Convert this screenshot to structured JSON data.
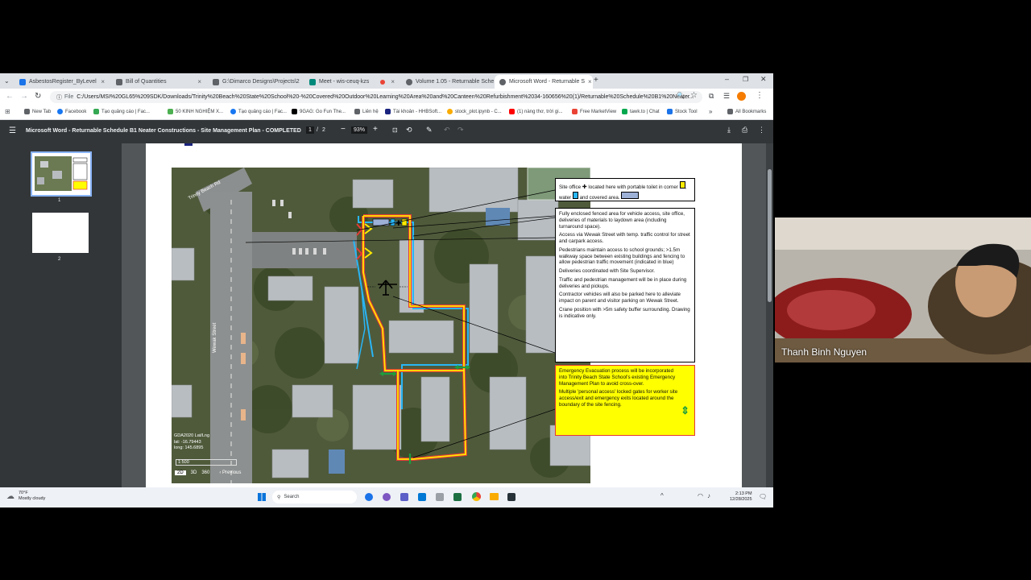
{
  "browser": {
    "tabs": [
      {
        "label": "AsbestosRegister_ByLevel",
        "color": "#1a73e8"
      },
      {
        "label": "Bill of Quantities",
        "color": "#5f6368"
      },
      {
        "label": "G:\\Dimarco Designs\\Projects\\2",
        "color": "#5f6368"
      },
      {
        "label": "Meet - wis-ceuq-kzs",
        "color": "#00897b"
      },
      {
        "label": "Volume 1.05 - Returnable Sche",
        "color": "#5f6368"
      },
      {
        "label": "Microsoft Word - Returnable S",
        "color": "#5f6368"
      }
    ],
    "new_tab": "+",
    "address": {
      "scheme": "File",
      "url": "C:/Users/MSI%20GL65%209SDK/Downloads/Trinity%20Beach%20State%20School%20-%20Covered%20Outdoor%20Learning%20Area%20and%20Canteen%20Refurbishment%2034-160656%20(1)/Returnable%20Schedule%20B1%20Neater..."
    },
    "bookmarks": [
      {
        "label": "New Tab",
        "color": "#5f6368"
      },
      {
        "label": "Facebook",
        "color": "#1877f2"
      },
      {
        "label": "Tạo quảng cáo | Fac...",
        "color": "#34a853"
      },
      {
        "label": "50 KINH NGHIỆM X...",
        "color": "#4caf50"
      },
      {
        "label": "Tạo quảng cáo | Fac...",
        "color": "#1877f2"
      },
      {
        "label": "9GAG: Go Fun The...",
        "color": "#000000"
      },
      {
        "label": "Liên hệ",
        "color": "#5f6368"
      },
      {
        "label": "Tài khoản - HHBSoft...",
        "color": "#1a237e"
      },
      {
        "label": "stock_plot.ipynb - C...",
        "color": "#f9ab00"
      },
      {
        "label": "(1) nàng thơ, trời gi...",
        "color": "#ff0000"
      },
      {
        "label": "Free MarketView",
        "color": "#ea4335"
      },
      {
        "label": "tawk.to | Chat",
        "color": "#03a84e"
      },
      {
        "label": "Stock Tool",
        "color": "#1a73e8"
      }
    ],
    "all_bookmarks": "All Bookmarks"
  },
  "pdf": {
    "title": "Microsoft Word - Returnable Schedule B1 Neater Constructions - Site Management Plan - COMPLETED",
    "page_current": "1",
    "page_sep": "/",
    "page_total": "2",
    "zoom": "93%",
    "thumbs": [
      "1",
      "2"
    ]
  },
  "document": {
    "callout_office": {
      "parts": [
        "Site office",
        "located here with portable toilet in corner",
        ", water",
        "and covered area."
      ]
    },
    "callout_main": [
      "Fully enclosed fenced area for vehicle access, site office, deliveries of materials to laydown area (including turnaround space).",
      "Access via Wewak Street with temp. traffic control for street and carpark access.",
      "Pedestrians maintain access to school grounds; >1.5m walkway space between existing buildings and fencing to allow pedestrian traffic movement (indicated in blue)",
      "Deliveries coordinated with Site Supervisor.",
      "Traffic and pedestrian management will be in place during deliveries and pickups.",
      "Contractor vehicles will also be parked here to alleviate impact on parent and visitor parking on Wewak Street.",
      "Crane position with >5m safety buffer surrounding. Drawing is indicative only."
    ],
    "callout_emergency": [
      "Emergency Evacuation process will be incorporated into Trinity Beach State School's existing Emergency Management Plan to avoid cross-over.",
      "Multiple 'personal access' locked gates for worker site access/exit and emergency exits located around the boundary of the site fencing."
    ],
    "map_info": [
      "GDA2020 Lat/Lng",
      "lat: -16.79443",
      "long: 145.6895"
    ],
    "map_scale": "1:500",
    "map_buttons": [
      "2D",
      "3D",
      "360"
    ],
    "map_nav": "Previous",
    "street_labels": [
      "Wewak Street",
      "Trinity Beach Rd"
    ]
  },
  "taskbar": {
    "weather_temp": "70°F",
    "weather_desc": "Mostly cloudy",
    "search_placeholder": "Search",
    "time": "2:13 PM",
    "date": "12/28/2025"
  },
  "video": {
    "participant_name": "Thanh Binh Nguyen"
  },
  "colors": {
    "fence_red": "#e53935",
    "fence_yellow": "#ffeb00",
    "pedestrian_blue": "#29b6f6",
    "emergency_bg": "#ffff00",
    "emergency_border": "#e53935",
    "gate_green": "#1e9e3e"
  }
}
